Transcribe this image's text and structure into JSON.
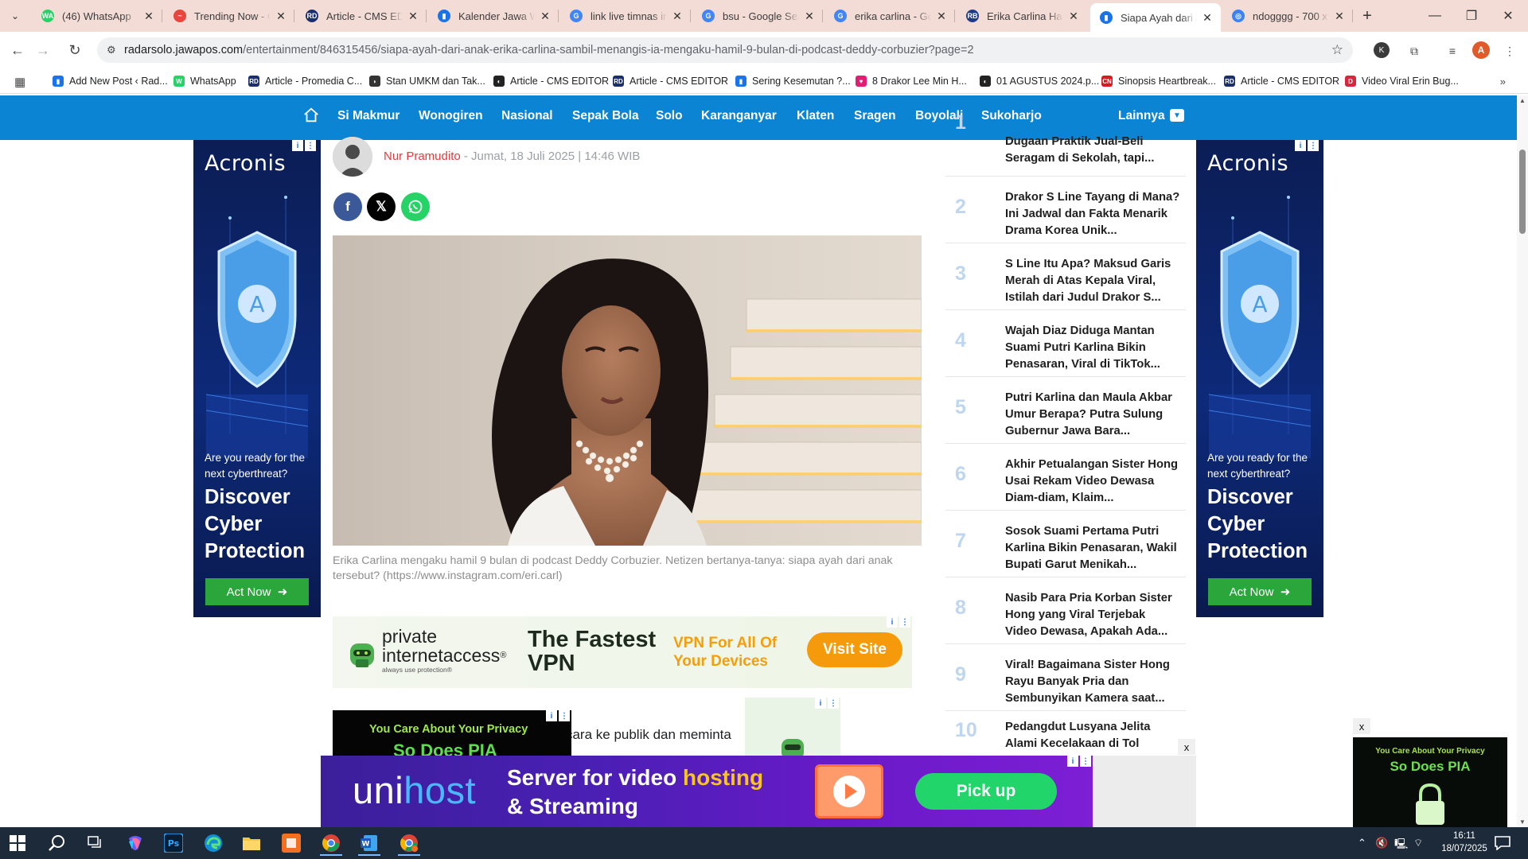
{
  "browser": {
    "tabs": [
      {
        "title": "(46) WhatsApp",
        "fav": "WA",
        "color": "#25d366"
      },
      {
        "title": "Trending Now - G",
        "fav": "~",
        "color": "#e8453c"
      },
      {
        "title": "Article - CMS EDIT",
        "fav": "RD",
        "color": "#1b2f6e"
      },
      {
        "title": "Kalender Jawa We",
        "fav": "▮",
        "color": "#1a73e8"
      },
      {
        "title": "link live timnas ind",
        "fav": "G",
        "color": "#4285f4"
      },
      {
        "title": "bsu - Google Sear",
        "fav": "G",
        "color": "#4285f4"
      },
      {
        "title": "erika carlina - Goo",
        "fav": "G",
        "color": "#4285f4"
      },
      {
        "title": "Erika Carlina Ham",
        "fav": "RB",
        "color": "#1e3a8a"
      },
      {
        "title": "Siapa Ayah dari A",
        "fav": "▮",
        "color": "#1a73e8"
      },
      {
        "title": "ndogggg - 700 x",
        "fav": "◎",
        "color": "#3b82f6"
      }
    ],
    "url_host": "radarsolo.jawapos.com",
    "url_path": "/entertainment/846315456/siapa-ayah-dari-anak-erika-carlina-sambil-menangis-ia-mengaku-hamil-9-bulan-di-podcast-deddy-corbuzier?page=2",
    "profile_initial": "A",
    "ext_initial": "K",
    "bookmarks": [
      {
        "label": "Add New Post ‹ Rad...",
        "fav": "▮",
        "color": "#1a73e8"
      },
      {
        "label": "WhatsApp",
        "fav": "W",
        "color": "#25d366"
      },
      {
        "label": "Article - Promedia C...",
        "fav": "RD",
        "color": "#1b2f6e"
      },
      {
        "label": "Stan UMKM dan Tak...",
        "fav": "◗",
        "color": "#333333"
      },
      {
        "label": "Article - CMS EDITOR",
        "fav": "◐",
        "color": "#222222"
      },
      {
        "label": "Article - CMS EDITOR",
        "fav": "RD",
        "color": "#1b2f6e"
      },
      {
        "label": "Sering Kesemutan ?...",
        "fav": "▮",
        "color": "#1a73e8"
      },
      {
        "label": "8 Drakor Lee Min H...",
        "fav": "♥",
        "color": "#e11d74"
      },
      {
        "label": "01 AGUSTUS 2024.p...",
        "fav": "◐",
        "color": "#222222"
      },
      {
        "label": "Sinopsis Heartbreak...",
        "fav": "CN",
        "color": "#d71920"
      },
      {
        "label": "Article - CMS EDITOR",
        "fav": "RD",
        "color": "#1b2f6e"
      },
      {
        "label": "Video Viral Erin Bug...",
        "fav": "D",
        "color": "#d7263d"
      }
    ]
  },
  "site": {
    "nav": [
      "Si Makmur",
      "Wonogiren",
      "Nasional",
      "Sepak Bola",
      "Solo",
      "Karanganyar",
      "Klaten",
      "Sragen",
      "Boyolali",
      "Sukoharjo"
    ],
    "more": "Lainnya",
    "accent": "#0b84d4"
  },
  "article": {
    "author": "Nur Pramudito",
    "date": " - Jumat, 18 Juli 2025 | 14:46 WIB",
    "caption": "Erika Carlina mengaku hamil 9 bulan di podcast Deddy Corbuzier. Netizen bertanya-tanya: siapa ayah dari anak tersebut? (https://www.instagram.com/eri.carl)",
    "body_fragment": "a bahkan membuat keputusan untuk bicara ke publik dan meminta maaf atas kesalahan"
  },
  "popular": [
    {
      "num": "1",
      "title": "Dugaan Praktik Jual-Beli Seragam di Sekolah, tapi..."
    },
    {
      "num": "2",
      "title": "Drakor S Line Tayang di Mana? Ini Jadwal dan Fakta Menarik Drama Korea Unik..."
    },
    {
      "num": "3",
      "title": "S Line Itu Apa? Maksud Garis Merah di Atas Kepala Viral, Istilah dari Judul Drakor S..."
    },
    {
      "num": "4",
      "title": "Wajah Diaz Diduga Mantan Suami Putri Karlina Bikin Penasaran, Viral di TikTok..."
    },
    {
      "num": "5",
      "title": "Putri Karlina dan Maula Akbar Umur Berapa? Putra Sulung Gubernur Jawa Bara..."
    },
    {
      "num": "6",
      "title": "Akhir Petualangan Sister Hong Usai Rekam Video Dewasa Diam-diam, Klaim..."
    },
    {
      "num": "7",
      "title": "Sosok Suami Pertama Putri Karlina Bikin Penasaran, Wakil Bupati Garut Menikah..."
    },
    {
      "num": "8",
      "title": "Nasib Para Pria Korban Sister Hong yang Viral Terjebak Video Dewasa, Apakah Ada..."
    },
    {
      "num": "9",
      "title": "Viral! Bagaimana Sister Hong Rayu Banyak Pria dan Sembunyikan Kamera saat..."
    },
    {
      "num": "10",
      "title": "Pedangdut Lusyana Jelita Alami Kecelakaan di Tol"
    }
  ],
  "ads": {
    "acronis": {
      "brand": "Acronis",
      "question": "Are you ready for the next cyberthreat?",
      "headline": "Discover Cyber Protection",
      "cta": "Act Now",
      "shield_letter": "A"
    },
    "pia": {
      "name1": "private",
      "name2": "internetaccess",
      "tagline": "always use protection",
      "headline": "The Fastest VPN",
      "sub": "VPN For All Of Your Devices",
      "cta": "Visit Site",
      "privacy1": "You Care About Your Privacy",
      "privacy2": "So Does PIA"
    },
    "unihost": {
      "brand_a": "uni",
      "brand_b": "host",
      "line1_a": "Server for ",
      "line1_b": "video",
      "line1_c": " hosting",
      "line2_a": "& ",
      "line2_b": "Streaming",
      "cta": "Pick up"
    },
    "close": "x"
  },
  "taskbar": {
    "time": "16:11",
    "date": "18/07/2025"
  }
}
